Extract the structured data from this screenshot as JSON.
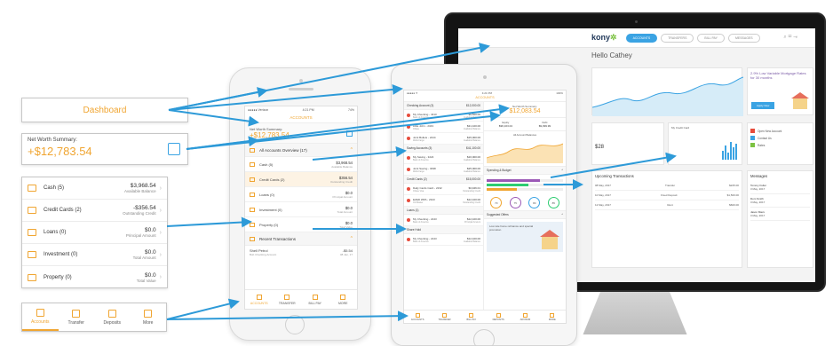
{
  "callouts": {
    "dashboard": "Dashboard",
    "net_worth_label": "Net Worth Summary:",
    "net_worth_value": "+$12,783.54",
    "accounts": [
      {
        "name": "Cash (5)",
        "amount": "$3,968.54",
        "sub": "Available Balance"
      },
      {
        "name": "Credit Cards (2)",
        "amount": "-$356.54",
        "sub": "Outstanding Credit"
      },
      {
        "name": "Loans (0)",
        "amount": "$0.0",
        "sub": "Principal Amount"
      },
      {
        "name": "Investment (0)",
        "amount": "$0.0",
        "sub": "Total Amount"
      },
      {
        "name": "Property (0)",
        "amount": "$0.0",
        "sub": "Total Value"
      }
    ],
    "nav": [
      "Accounts",
      "Transfer",
      "Deposits",
      "More"
    ]
  },
  "iphone": {
    "status_left": "●●●●● Verizon",
    "status_time": "4:21 PM",
    "status_right": "74%",
    "title": "ACCOUNTS",
    "net_worth_label": "Net Worth Summary:",
    "net_worth_value": "+$12,783.54",
    "overview_label": "All Accounts Overview (17)",
    "rows": [
      {
        "name": "Cash (5)",
        "amount": "$3,968.54",
        "sub": "Available Balance"
      },
      {
        "name": "Credit Cards (2)",
        "amount": "$356.54",
        "sub": "Outstanding Credit"
      },
      {
        "name": "Loans (0)",
        "amount": "$0.0",
        "sub": "Principal Amount"
      },
      {
        "name": "Investment (0)",
        "amount": "$0.0",
        "sub": "Total Amount"
      },
      {
        "name": "Property (0)",
        "amount": "$0.0",
        "sub": "Total Value"
      }
    ],
    "recent_label": "Recent Transactions",
    "txn_name": "Shell Petrol",
    "txn_sub": "Bob Checking Account",
    "txn_amount": "-$5.54",
    "txn_date": "08 Jan, 17",
    "nav": [
      "ACCOUNTS",
      "TRANSFER",
      "BILL PAY",
      "MORE"
    ]
  },
  "ipad": {
    "status_left": "●●●●● ✈",
    "status_time": "4:21 PM",
    "status_right": "100%",
    "title": "ACCOUNTS",
    "left_sections": [
      {
        "head": "Checking Account (3)",
        "total": "$12,000.00",
        "rows": [
          {
            "name": "My Checking - 4310",
            "sub": "Bank of America",
            "amt": "$4,500.00",
            "asub": "Available Balance"
          },
          {
            "name": "Little John - 2343",
            "sub": "Chase",
            "amt": "$31,100.00",
            "asub": "Available Balance"
          },
          {
            "name": "Joint Bullets - 2244",
            "sub": "Wells Fargo",
            "amt": "$15,000.00",
            "asub": "Available Balance"
          }
        ]
      },
      {
        "head": "Saving Accounts (3)",
        "total": "$41,100.00",
        "rows": [
          {
            "name": "My Saving - 3224",
            "sub": "Bank of America",
            "amt": "$16,000.00",
            "asub": "Available Balance"
          },
          {
            "name": "Joint Saving - 3098",
            "sub": "Wells Fargo",
            "amt": "$25,000.00",
            "asub": "Available Balance"
          }
        ]
      },
      {
        "head": "Credit Cards (2)",
        "total": "$15,000.00",
        "rows": [
          {
            "name": "Daily Cards Cash - 2232",
            "sub": "Chase Visa",
            "amt": "$3,946.01",
            "asub": "Outstanding Credit"
          },
          {
            "name": "EZED WPA - 2343",
            "sub": "Citi Master",
            "amt": "$12,100.00",
            "asub": "Outstanding Credit"
          }
        ]
      },
      {
        "head": "Loans (1)",
        "total": "",
        "rows": [
          {
            "name": "My Checking - 2243",
            "sub": "Bank of America",
            "amt": "$12,100.00",
            "asub": "Principal Amount"
          }
        ]
      },
      {
        "head": "Share Hold",
        "total": "",
        "rows": [
          {
            "name": "My Checking - 2243",
            "sub": "Bank of America",
            "amt": "$12,100.00",
            "asub": "Available Balance"
          }
        ]
      }
    ],
    "net_worth_label": "Net Worth Summary:",
    "net_worth_value": "$12,083.54",
    "stats": [
      {
        "label": "Equity",
        "value": "$96,163.04"
      },
      {
        "label": "Debt",
        "value": "$9,099.99"
      }
    ],
    "chart_title": "All Account Balances",
    "spending_label": "Spending & Budget",
    "offers_label": "Suggested Offers",
    "offer_text": "Low rate home refinance and special promotion",
    "nav": [
      "ACCOUNTS",
      "TRANSFER",
      "BILL PAY",
      "DEPOSITS",
      "ADVISOR",
      "MORE"
    ]
  },
  "imac": {
    "logo": "kony",
    "tabs": [
      "ACCOUNTS",
      "TRANSFERS",
      "BILL PAY",
      "MESSAGES"
    ],
    "user": "Hello Cathey",
    "promo_text": "2.9% Low Variable Mortgage Rates for 30 months",
    "promo_button": "Apply Now",
    "credit_card_label": "My Credit Card",
    "card_value": "$28",
    "quick_links": [
      "Open New Account",
      "Contact Us",
      "Rates"
    ],
    "upcoming_label": "Upcoming Transactions",
    "upcoming": [
      {
        "date": "08 May, 2017",
        "name": "Transfer",
        "amount": "$225.00"
      },
      {
        "date": "10 May, 2017",
        "name": "Fixed Deposit",
        "amount": "$1,500.00"
      },
      {
        "date": "12 May, 2017",
        "name": "Rent",
        "amount": "$600.00"
      }
    ],
    "messages_label": "Messages",
    "messages": [
      {
        "name": "Tommy Fuller",
        "date": "3 May, 2017"
      },
      {
        "name": "Dom Smith",
        "date": "3 May, 2017"
      },
      {
        "name": "Jason Maxx",
        "date": "3 May, 2017"
      }
    ]
  },
  "colors": {
    "accent": "#f0a531",
    "link": "#3aa3e3"
  }
}
